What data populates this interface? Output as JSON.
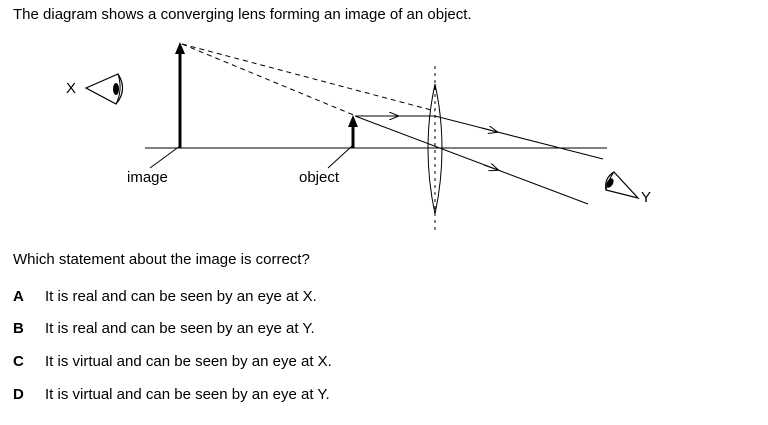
{
  "intro": "The diagram shows a converging lens forming an image of an object.",
  "diagram": {
    "label_x": "X",
    "label_y": "Y",
    "label_image": "image",
    "label_object": "object"
  },
  "question": "Which statement about the image is correct?",
  "options": [
    {
      "letter": "A",
      "text": "It is real and can be seen by an eye at X."
    },
    {
      "letter": "B",
      "text": "It is real and can be seen by an eye at Y."
    },
    {
      "letter": "C",
      "text": "It is virtual and can be seen by an eye at X."
    },
    {
      "letter": "D",
      "text": "It is virtual and can be seen by an eye at Y."
    }
  ]
}
